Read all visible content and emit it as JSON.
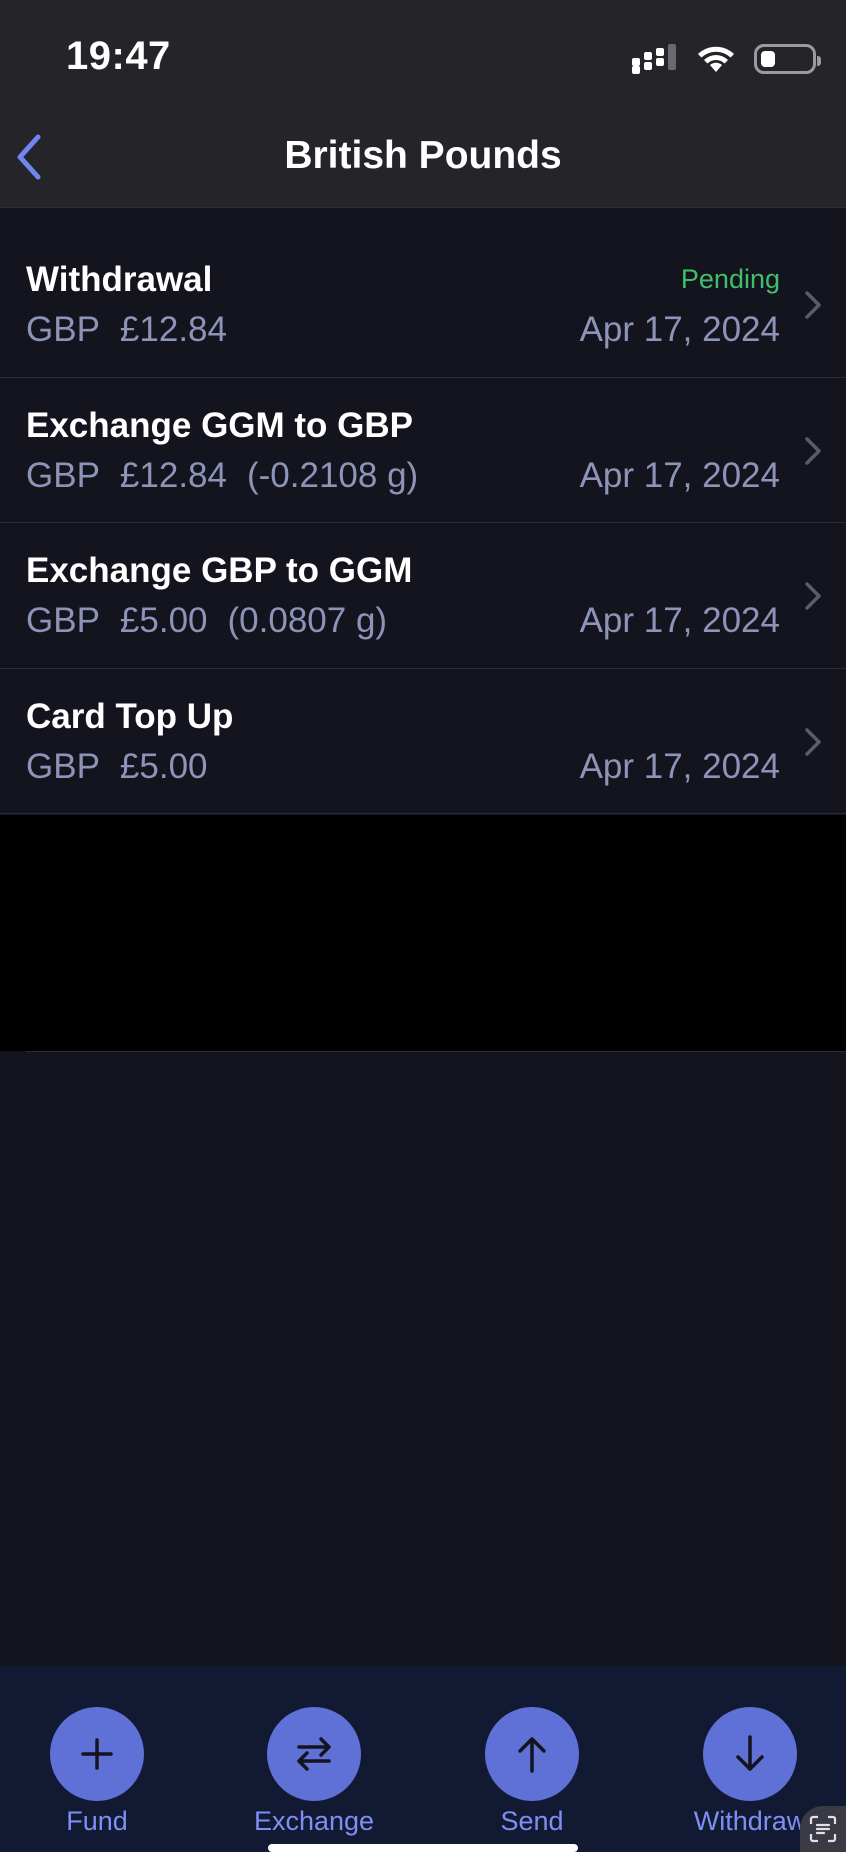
{
  "status_bar": {
    "time": "19:47",
    "icons": [
      "cellular-signal-icon",
      "wifi-icon",
      "battery-icon"
    ]
  },
  "nav": {
    "title": "British Pounds",
    "back_icon": "chevron-left-icon"
  },
  "transactions": [
    {
      "title": "Withdrawal",
      "currency": "GBP",
      "amount": "£12.84",
      "grams": "",
      "status": "Pending",
      "date": "Apr 17, 2024"
    },
    {
      "title": "Exchange GGM to GBP",
      "currency": "GBP",
      "amount": "£12.84",
      "grams": "(-0.2108 g)",
      "status": "",
      "date": "Apr 17, 2024"
    },
    {
      "title": "Exchange GBP to GGM",
      "currency": "GBP",
      "amount": "£5.00",
      "grams": "(0.0807 g)",
      "status": "",
      "date": "Apr 17, 2024"
    },
    {
      "title": "Card Top Up",
      "currency": "GBP",
      "amount": "£5.00",
      "grams": "",
      "status": "",
      "date": "Apr 17, 2024"
    }
  ],
  "actions": [
    {
      "label": "Fund",
      "icon": "plus-icon"
    },
    {
      "label": "Exchange",
      "icon": "swap-arrows-icon"
    },
    {
      "label": "Send",
      "icon": "arrow-up-icon"
    },
    {
      "label": "Withdraw",
      "icon": "arrow-down-icon"
    }
  ],
  "colors": {
    "background": "#14141f",
    "header": "#242429",
    "accent": "#5f70d6",
    "accent_text": "#7f8ef2",
    "pending": "#3fbf6b",
    "secondary_text": "#8e93b8"
  }
}
